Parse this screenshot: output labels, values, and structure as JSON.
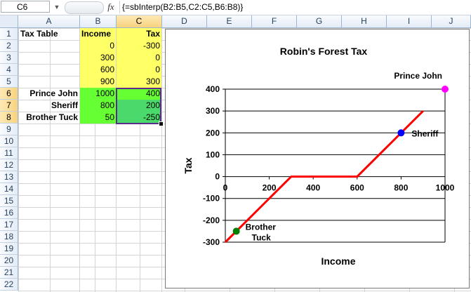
{
  "formula_bar": {
    "name_box": "C6",
    "fx_icon": "fx-icon",
    "formula": "{=sbInterp(B2:B5,C2:C5,B6:B8)}"
  },
  "columns": [
    "A",
    "B",
    "C",
    "D",
    "E",
    "F",
    "G",
    "H",
    "I",
    "J"
  ],
  "rows": [
    "1",
    "2",
    "3",
    "4",
    "5",
    "6",
    "7",
    "8",
    "9",
    "10",
    "11",
    "12",
    "13",
    "14",
    "15",
    "16",
    "17",
    "18",
    "19",
    "20",
    "21",
    "22"
  ],
  "cells": {
    "A1": "Tax Table",
    "B1": "Income",
    "C1": "Tax",
    "B2": "0",
    "C2": "-300",
    "B3": "300",
    "C3": "0",
    "B4": "600",
    "C4": "0",
    "B5": "900",
    "C5": "300",
    "A6": "Prince John",
    "B6": "1000",
    "C6": "400",
    "A7": "Sheriff",
    "B7": "800",
    "C7": "200",
    "A8": "Brother Tuck",
    "B8": "50",
    "C8": "-250"
  },
  "colors": {
    "yellow_fill": "#ffff66",
    "green_fill": "#66ff33",
    "selection_fill": "#4cd96b",
    "line": "#ff0000"
  },
  "chart_data": {
    "type": "line",
    "title": "Robin's Forest Tax",
    "xlabel": "Income",
    "ylabel": "Tax",
    "xlim": [
      0,
      1000
    ],
    "ylim": [
      -300,
      400
    ],
    "xticks": [
      "0",
      "200",
      "400",
      "600",
      "800",
      "1000"
    ],
    "yticks": [
      "400",
      "300",
      "200",
      "100",
      "0",
      "-100",
      "-200",
      "-300"
    ],
    "series": [
      {
        "x": [
          0,
          300,
          600,
          900
        ],
        "y": [
          -300,
          0,
          0,
          300
        ],
        "color": "#ff0000"
      }
    ],
    "points": [
      {
        "name": "Prince John",
        "x": 1000,
        "y": 400,
        "color": "#ff00ff"
      },
      {
        "name": "Sheriff",
        "x": 800,
        "y": 200,
        "color": "#0000ff"
      },
      {
        "name": "Brother Tuck",
        "x": 50,
        "y": -250,
        "color": "#008000"
      }
    ],
    "grid": "horizontal"
  }
}
